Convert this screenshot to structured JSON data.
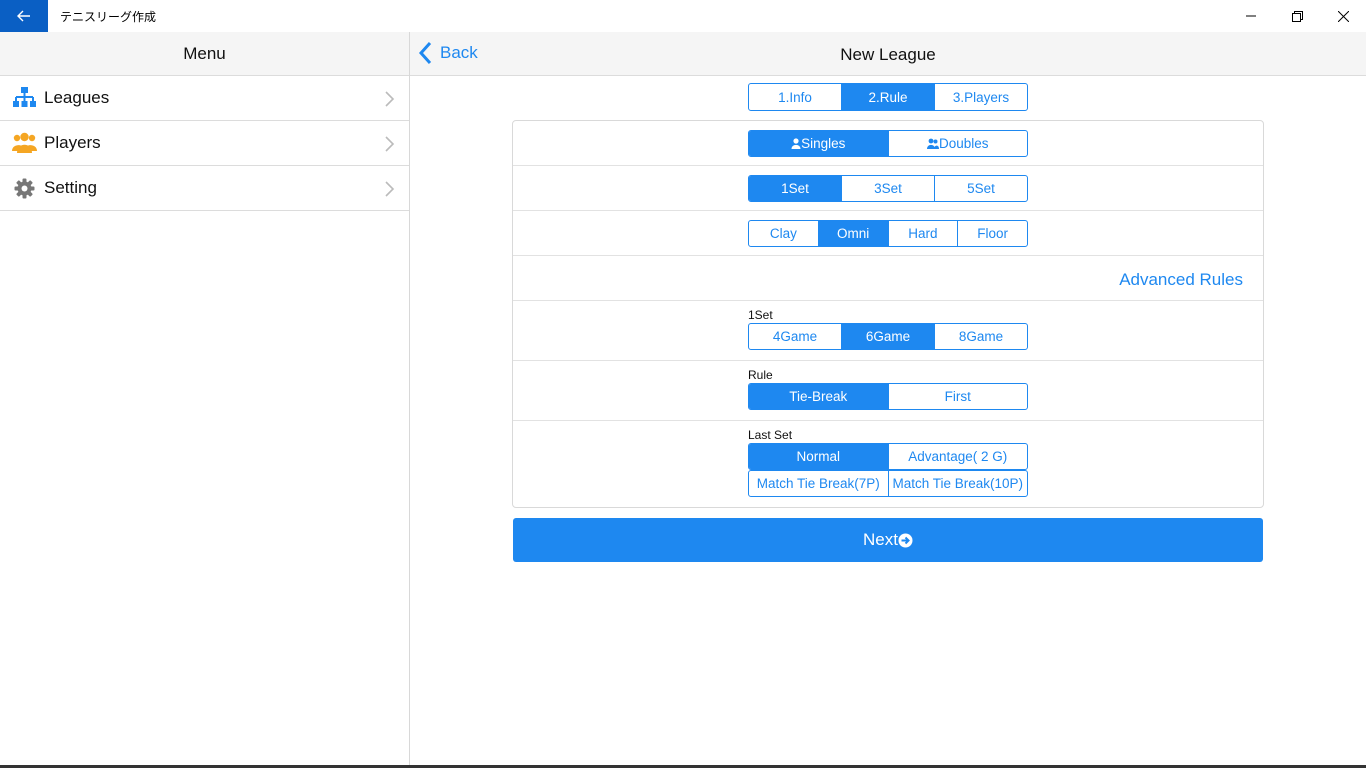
{
  "titlebar": {
    "title": "テニスリーグ作成",
    "back_icon": "arrow-left-icon",
    "accent": "#0a5fc4"
  },
  "sidebar": {
    "header": "Menu",
    "items": [
      {
        "label": "Leagues",
        "icon": "sitemap-icon",
        "icon_color": "#1e88f0"
      },
      {
        "label": "Players",
        "icon": "users-icon",
        "icon_color": "#f5a623"
      },
      {
        "label": "Setting",
        "icon": "gear-icon",
        "icon_color": "#777777"
      }
    ]
  },
  "main": {
    "back_label": "Back",
    "title": "New League",
    "steps": [
      {
        "label": "1.Info",
        "active": false
      },
      {
        "label": "2.Rule",
        "active": true
      },
      {
        "label": "3.Players",
        "active": false
      }
    ],
    "match_type": [
      {
        "label": "Singles",
        "icon": "user-icon",
        "active": true
      },
      {
        "label": "Doubles",
        "icon": "users-icon",
        "active": false
      }
    ],
    "sets": [
      {
        "label": "1Set",
        "active": true
      },
      {
        "label": "3Set",
        "active": false
      },
      {
        "label": "5Set",
        "active": false
      }
    ],
    "surface": [
      {
        "label": "Clay",
        "active": false
      },
      {
        "label": "Omni",
        "active": true
      },
      {
        "label": "Hard",
        "active": false
      },
      {
        "label": "Floor",
        "active": false
      }
    ],
    "advanced_label": "Advanced Rules",
    "games": {
      "label": "1Set",
      "options": [
        {
          "label": "4Game",
          "active": false
        },
        {
          "label": "6Game",
          "active": true
        },
        {
          "label": "8Game",
          "active": false
        }
      ]
    },
    "rule": {
      "label": "Rule",
      "options": [
        {
          "label": "Tie-Break",
          "active": true
        },
        {
          "label": "First",
          "active": false
        }
      ]
    },
    "last_set": {
      "label": "Last Set",
      "options": [
        {
          "label": "Normal",
          "active": true
        },
        {
          "label": "Advantage( 2 G)",
          "active": false
        },
        {
          "label": "Match Tie Break(7P)",
          "active": false
        },
        {
          "label": "Match Tie Break(10P)",
          "active": false
        }
      ]
    },
    "next_label": "Next",
    "next_icon": "arrow-circle-right-icon",
    "accent": "#1e88f0"
  }
}
